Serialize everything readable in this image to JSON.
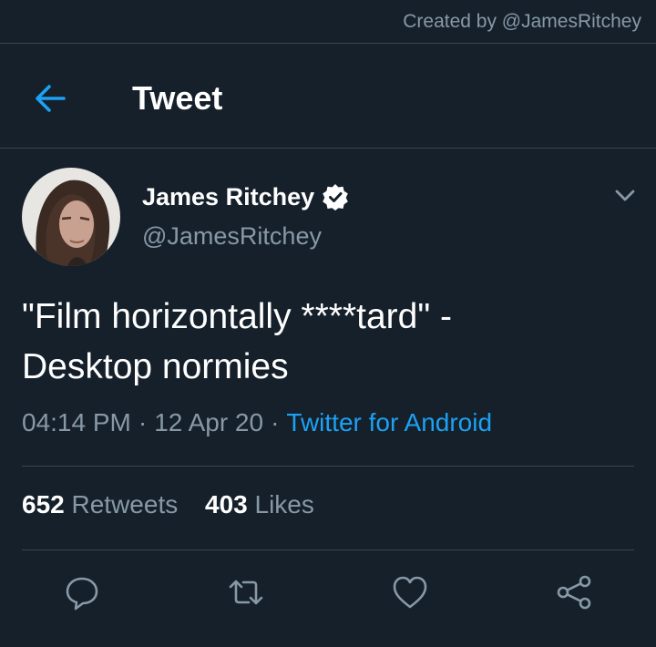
{
  "watermark": "Created by @JamesRitchey",
  "header": {
    "title": "Tweet",
    "back_icon": "back-arrow-icon"
  },
  "author": {
    "display_name": "James Ritchey",
    "handle": "@JamesRitchey",
    "verified": true,
    "verified_icon": "verified-badge-icon",
    "menu_icon": "chevron-down-icon"
  },
  "tweet": {
    "text_line1": "\"Film horizontally ****tard\" -",
    "text_line2": "Desktop normies",
    "time": "04:14 PM",
    "date": "12 Apr 20",
    "source": "Twitter for Android",
    "separator": "·"
  },
  "stats": {
    "retweets_count": "652",
    "retweets_label": "Retweets",
    "likes_count": "403",
    "likes_label": "Likes"
  },
  "actions": [
    {
      "name": "reply",
      "icon": "reply-icon"
    },
    {
      "name": "retweet",
      "icon": "retweet-icon"
    },
    {
      "name": "like",
      "icon": "heart-icon"
    },
    {
      "name": "share",
      "icon": "share-icon"
    }
  ],
  "colors": {
    "background": "#15202b",
    "accent": "#1da1f2",
    "muted": "#8899a6",
    "divider": "#38444d"
  }
}
